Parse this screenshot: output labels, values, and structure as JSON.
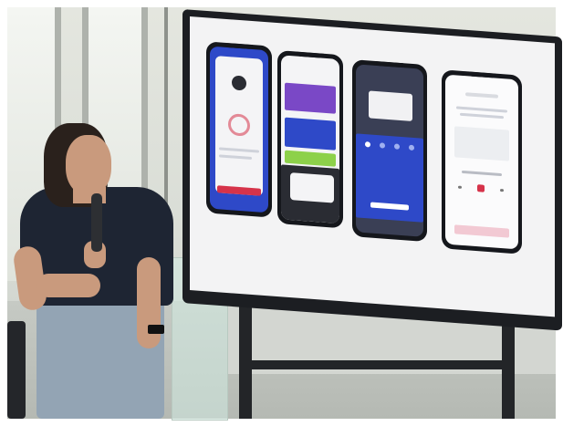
{
  "scene": {
    "shirt_logo": "",
    "colors": {
      "screen_bg": "#f3f3f4",
      "phone_blue": "#2e49c8",
      "phone_purple": "#7a48c6",
      "phone_green": "#8dd14a",
      "phone_pink": "#f2c9d3",
      "accent_red": "#d6334a",
      "shirt": "#1e2533",
      "jeans": "#93a4b4"
    }
  }
}
